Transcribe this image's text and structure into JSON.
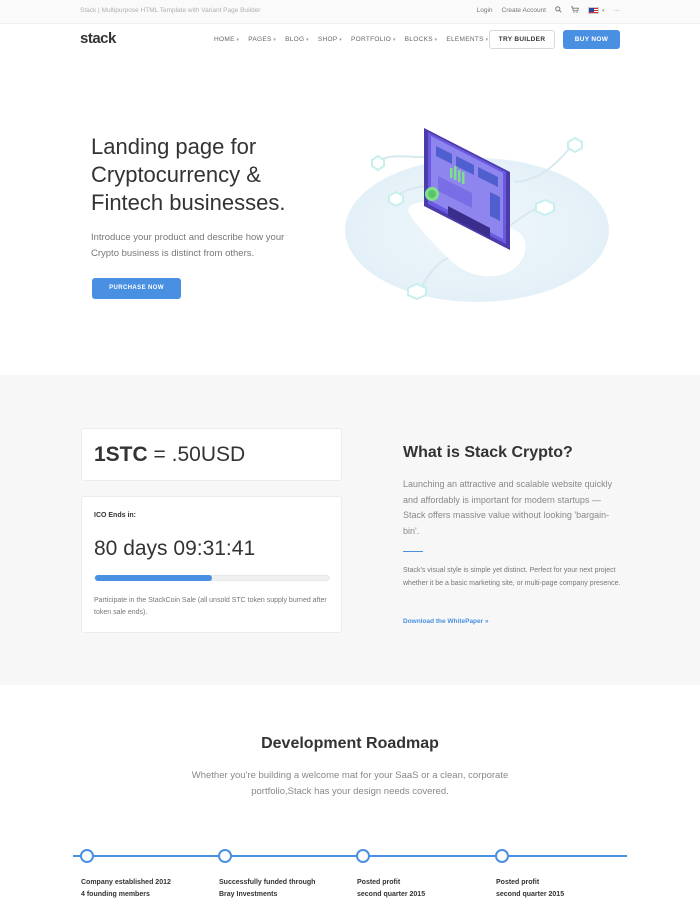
{
  "utility": {
    "tagline": "Stack | Multipurpose HTML Template with Variant Page Builder",
    "login": "Login",
    "create_account": "Create Account",
    "search_icon": "search-icon",
    "cart_icon": "cart-icon",
    "flag_icon": "us-flag-icon",
    "more_icon": "ellipsis-icon"
  },
  "nav": {
    "logo": "stack",
    "items": [
      "HOME",
      "PAGES",
      "BLOG",
      "SHOP",
      "PORTFOLIO",
      "BLOCKS",
      "ELEMENTS"
    ],
    "try_builder": "TRY BUILDER",
    "buy_now": "BUY NOW"
  },
  "hero": {
    "title": "Landing page for Cryptocurrency & Fintech businesses.",
    "subtitle": "Introduce your product and describe how your Crypto business is distinct from others.",
    "cta": "PURCHASE NOW"
  },
  "price": {
    "token": "1STC",
    "rate": " = .50USD"
  },
  "ico": {
    "label": "ICO Ends in:",
    "countdown": "80 days 09:31:41",
    "progress": 0.5,
    "note": "Participate in the StackCoin Sale (all unsold STC token supply burned after token sale ends)."
  },
  "about": {
    "title": "What is Stack Crypto?",
    "lead": "Launching an attractive and scalable website quickly and affordably is important for modern startups — Stack offers massive value without looking 'bargain-bin'.",
    "body": "Stack's visual style is simple yet distinct. Perfect for your next project whether it be a basic marketing site, or multi-page company presence.",
    "link": "Download the WhitePaper »"
  },
  "roadmap": {
    "title": "Development Roadmap",
    "subtitle": "Whether you're building a welcome mat for your SaaS or a clean, corporate portfolio,Stack has your design needs covered.",
    "milestones": [
      {
        "line1": "Company established 2012",
        "line2": "4 founding members"
      },
      {
        "line1": "Successfully funded through",
        "line2": "Bray Investments"
      },
      {
        "line1": "Posted profit",
        "line2": "second quarter 2015"
      },
      {
        "line1": "Posted profit",
        "line2": "second quarter 2015"
      }
    ]
  },
  "colors": {
    "accent": "#4a90e2",
    "section_bg": "#f7f7f7",
    "illustration_purple": "#5b4bb7",
    "illustration_glow": "#bff0ee"
  }
}
